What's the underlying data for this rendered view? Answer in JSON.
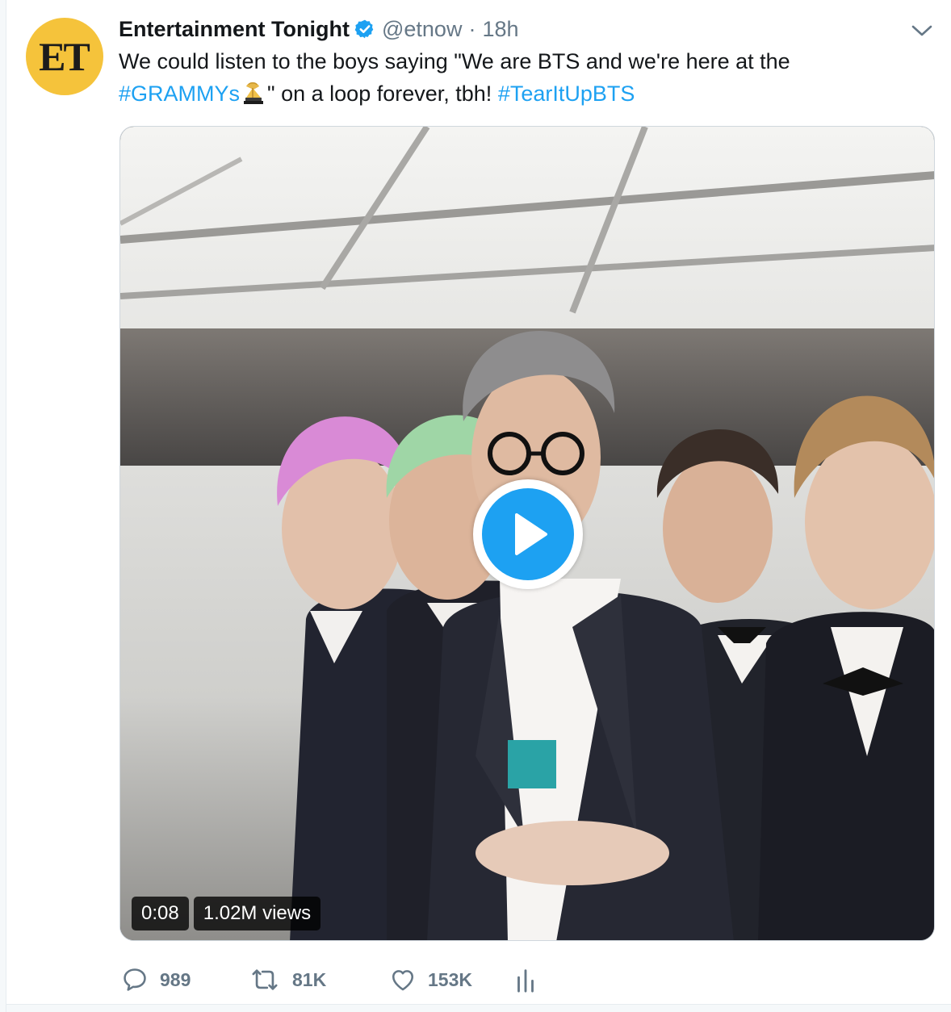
{
  "tweet": {
    "avatar_text": "ET",
    "display_name": "Entertainment Tonight",
    "handle": "@etnow",
    "separator": "·",
    "time": "18h",
    "text_line1": "We could listen to the boys saying \"We are BTS and we're here at the",
    "hashtag1": "#GRAMMYs",
    "text_mid": "\" on a loop forever, tbh!",
    "hashtag2": "#TearItUpBTS"
  },
  "media": {
    "duration": "0:08",
    "views": "1.02M views"
  },
  "actions": {
    "replies": "989",
    "retweets": "81K",
    "likes": "153K"
  },
  "colors": {
    "accent": "#1da1f2",
    "muted": "#657786",
    "avatar_bg": "#f5c33b"
  },
  "icons": [
    "verified-badge-icon",
    "chevron-down-icon",
    "grammy-trophy-icon",
    "play-icon",
    "reply-icon",
    "retweet-icon",
    "heart-icon",
    "analytics-icon"
  ]
}
